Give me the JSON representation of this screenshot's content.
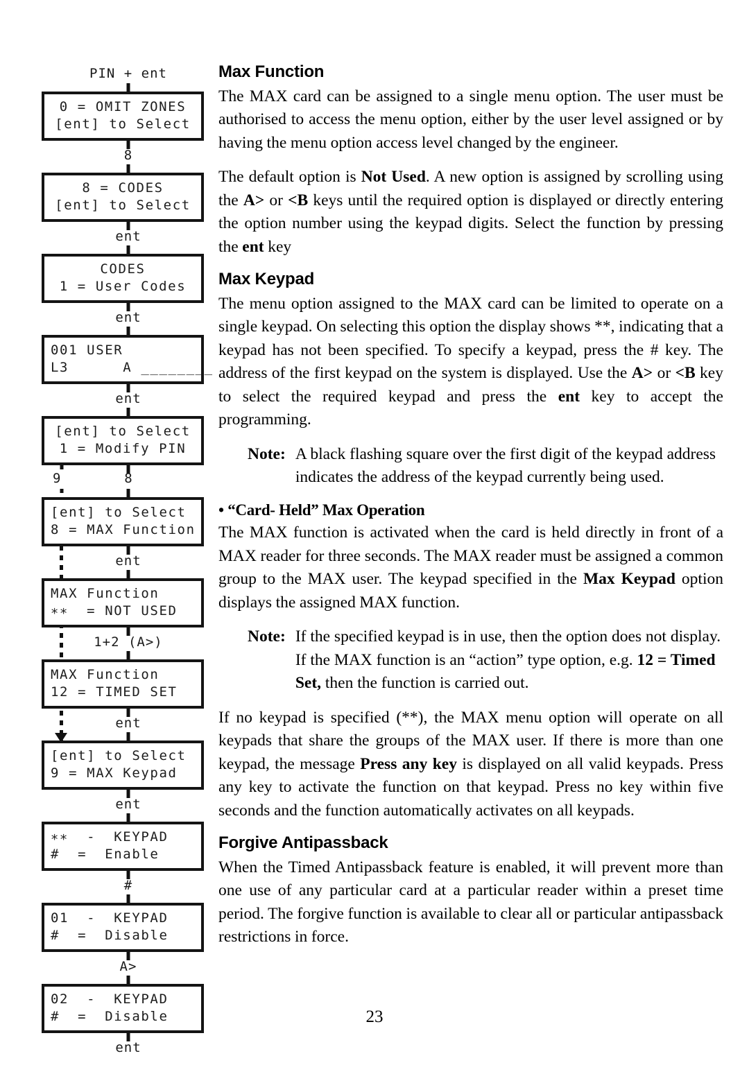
{
  "page": {
    "number": "23"
  },
  "flowchart": {
    "start_label": "PIN + ent",
    "steps": [
      {
        "line1": "0 = OMIT ZONES",
        "line2": "[ent] to Select",
        "align": "center"
      },
      {
        "line1": "8 = CODES",
        "line2": "[ent] to Select",
        "align": "center"
      },
      {
        "line1": "CODES",
        "line2": "1 = User Codes",
        "align": "center"
      },
      {
        "line1": "001 USER",
        "line2": "L3      A ________",
        "align": "left"
      },
      {
        "line1": "[ent] to Select",
        "line2": "1 = Modify PIN",
        "align": "center"
      },
      {
        "line1": "[ent] to Select",
        "line2": "8 = MAX Function",
        "align": "left"
      },
      {
        "line1": "MAX Function",
        "line2": "∗∗  = NOT USED",
        "align": "left"
      },
      {
        "line1": "MAX Function",
        "line2": "12 = TIMED SET",
        "align": "left"
      },
      {
        "line1": "[ent] to Select",
        "line2": "9 = MAX Keypad",
        "align": "left"
      },
      {
        "line1": "∗∗  -  KEYPAD",
        "line2": "#  =  Enable",
        "align": "left"
      },
      {
        "line1": "01  -  KEYPAD",
        "line2": "#  =  Disable",
        "align": "left"
      },
      {
        "line1": "02  -  KEYPAD",
        "line2": "#  =  Disable",
        "align": "left"
      }
    ],
    "connectors": {
      "c1": "8",
      "c2": "ent",
      "c3": "ent",
      "c4": "ent",
      "branch_left": "9",
      "branch_right": "8",
      "c5": "ent",
      "c6": "1+2 (A>)",
      "c7": "ent",
      "c8": "ent",
      "c9": "#",
      "c10": "A>",
      "c11": "ent"
    }
  },
  "content": {
    "max_function": {
      "heading": "Max Function",
      "para1": "The MAX card can be assigned to a single menu option. The user must be authorised to access the menu option, either by the user level assigned or by having the menu option access level changed by the engineer.",
      "para2_a": "The default option is ",
      "para2_b": "Not Used",
      "para2_c": ".  A new option is assigned by scrolling using the ",
      "para2_d": "A>",
      "para2_e": " or ",
      "para2_f": "<B",
      "para2_g": " keys until the required option is displayed or directly entering the option number using the keypad digits. Select the function by pressing the ",
      "para2_h": "ent",
      "para2_i": " key"
    },
    "max_keypad": {
      "heading": "Max Keypad",
      "para_a": "The menu option assigned to the MAX card can be limited to operate on a single keypad. On selecting this option the display shows **, indicating that a keypad has not been specified. To specify a keypad, press the # key. The address of the first keypad on the system is displayed. Use the ",
      "para_b": "A>",
      "para_c": " or ",
      "para_d": "<B",
      "para_e": " key to select the required keypad and press the ",
      "para_f": "ent",
      "para_g": " key to accept the programming."
    },
    "note1": {
      "keyword": "Note:",
      "text": "A black flashing square over the first digit of the keypad address indicates the address of the keypad currently being used."
    },
    "card_held": {
      "heading": "• “Card- Held” Max Operation",
      "para_a": "The MAX function is activated when the card is held directly in front of a MAX reader for three seconds. The MAX reader must be assigned a common group to the MAX user. The keypad specified in the ",
      "para_b": "Max Keypad",
      "para_c": " option displays the assigned MAX function."
    },
    "note2": {
      "keyword": "Note:",
      "text_a": "If the specified keypad is in use, then the option does not display. If the MAX function is an “action” type option, e.g. ",
      "text_b": "12 = Timed Set,",
      "text_c": " then the function is carried out."
    },
    "no_keypad": {
      "para_a": "If no keypad is specified (**), the MAX menu option will operate on all keypads that share the groups of the MAX user. If there is more than one keypad, the message ",
      "para_b": "Press any key",
      "para_c": " is displayed on all valid keypads. Press any key to activate the function on that keypad. Press no key within five seconds and the function automatically activates on all keypads."
    },
    "forgive": {
      "heading": "Forgive Antipassback",
      "para": "When the Timed Antipassback feature is enabled, it will prevent more than one use of any particular card at a particular reader within a preset time period. The forgive function is available to clear all or particular antipassback restrictions in force."
    }
  }
}
